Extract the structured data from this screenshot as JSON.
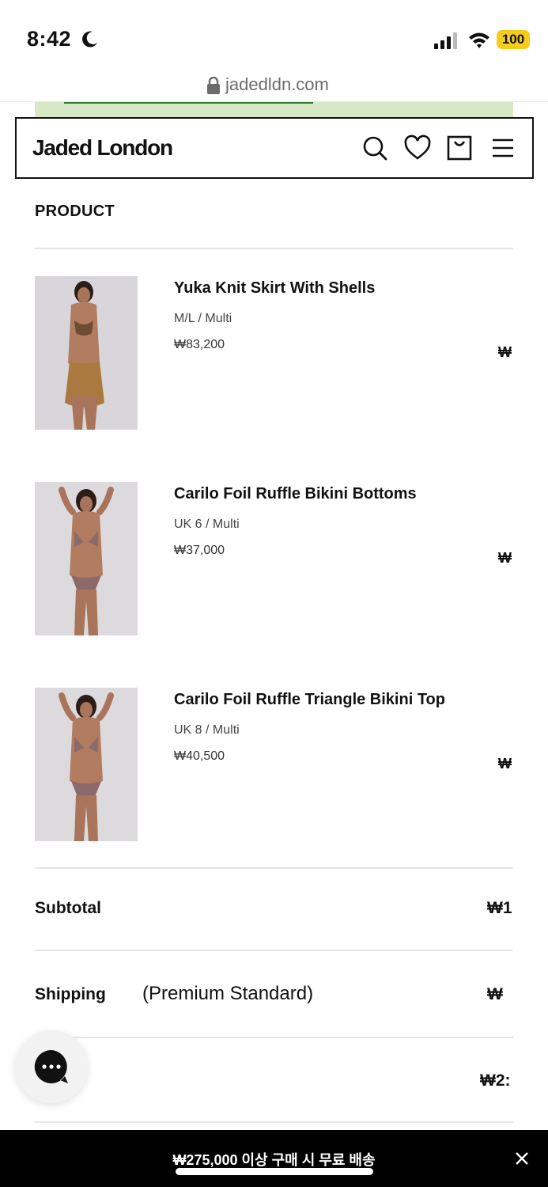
{
  "status_bar": {
    "time": "8:42",
    "battery": "100"
  },
  "browser": {
    "url": "jadedldn.com"
  },
  "header": {
    "logo": "Jaded London"
  },
  "cart": {
    "section_heading": "PRODUCT",
    "items": [
      {
        "name": "Yuka Knit Skirt With Shells",
        "variant": "M/L / Multi",
        "price": "₩83,200",
        "total": "₩"
      },
      {
        "name": "Carilo Foil Ruffle Bikini Bottoms",
        "variant": "UK 6 / Multi",
        "price": "₩37,000",
        "total": "₩"
      },
      {
        "name": "Carilo Foil Ruffle Triangle Bikini Top",
        "variant": "UK 8 / Multi",
        "price": "₩40,500",
        "total": "₩"
      }
    ],
    "subtotal_label": "Subtotal",
    "subtotal_value": "₩1",
    "shipping_label": "Shipping",
    "shipping_method": "(Premium Standard)",
    "shipping_value": "₩",
    "total_value": "₩2:"
  },
  "banner": {
    "text": "₩275,000 이상 구매 시 무료 배송"
  },
  "colors": {
    "promo_bg": "#d6e8c6",
    "battery": "#f6cc1a",
    "banner_bg": "#000000"
  }
}
